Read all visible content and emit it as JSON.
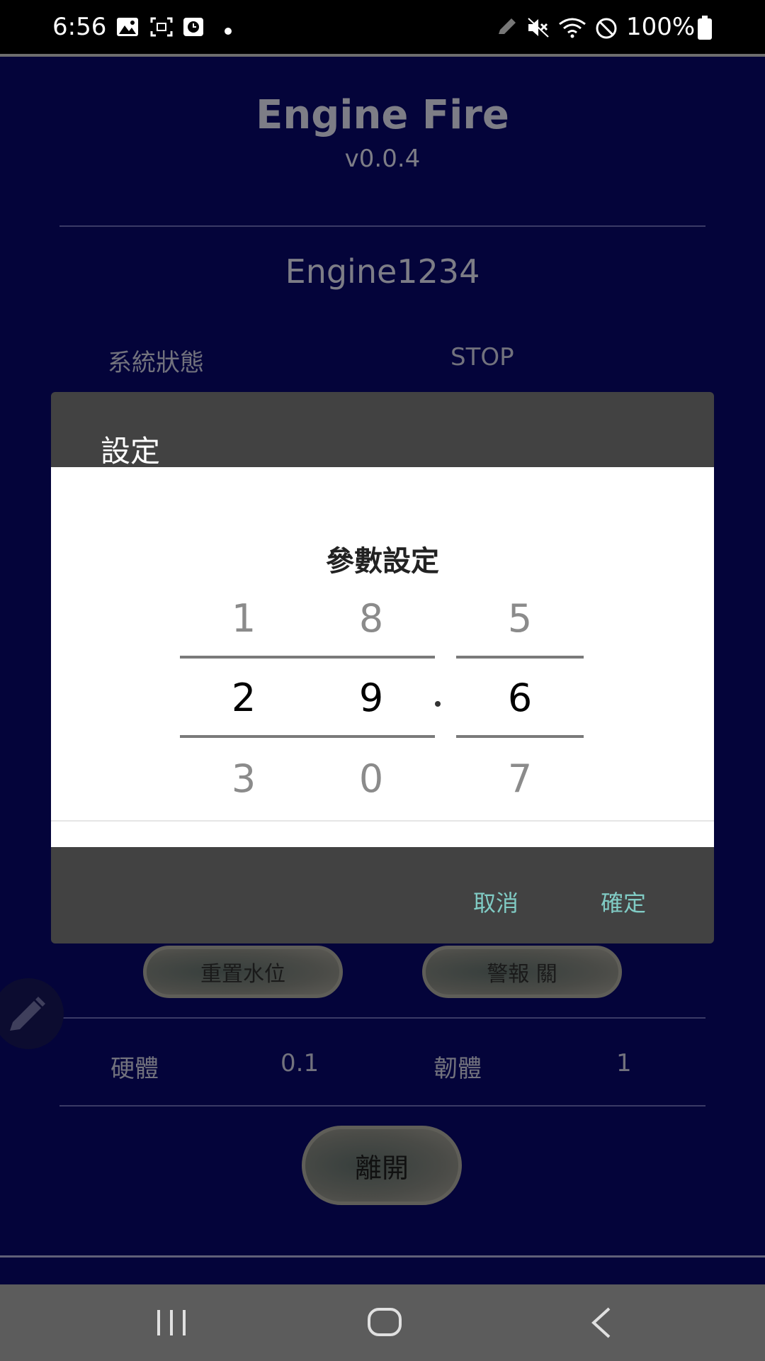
{
  "status_bar": {
    "time": "6:56",
    "battery": "100%",
    "icons_left": [
      "image-icon",
      "screenshot-icon",
      "clock-app-icon",
      "dot-icon"
    ],
    "icons_right": [
      "pen-icon",
      "mute-icon",
      "wifi-icon",
      "dnd-icon",
      "battery-icon"
    ]
  },
  "app": {
    "title": "Engine Fire",
    "version": "v0.0.4",
    "device_name": "Engine1234",
    "system_status_label": "系統狀態",
    "system_status_value": "STOP",
    "reset_button": "重置水位",
    "alarm_button": "警報 關",
    "hardware_label": "硬體",
    "hardware_value": "0.1",
    "firmware_label": "韌體",
    "firmware_value": "1",
    "exit_button": "離開"
  },
  "dialog": {
    "title": "設定",
    "picker_title": "參數設定",
    "columns": [
      {
        "prev": "1",
        "selected": "2",
        "next": "3"
      },
      {
        "prev": "8",
        "selected": "9",
        "next": "0"
      },
      {
        "prev": "5",
        "selected": "6",
        "next": "7"
      }
    ],
    "separator": ".",
    "cancel": "取消",
    "confirm": "確定",
    "accent_color": "#80cbc4"
  }
}
